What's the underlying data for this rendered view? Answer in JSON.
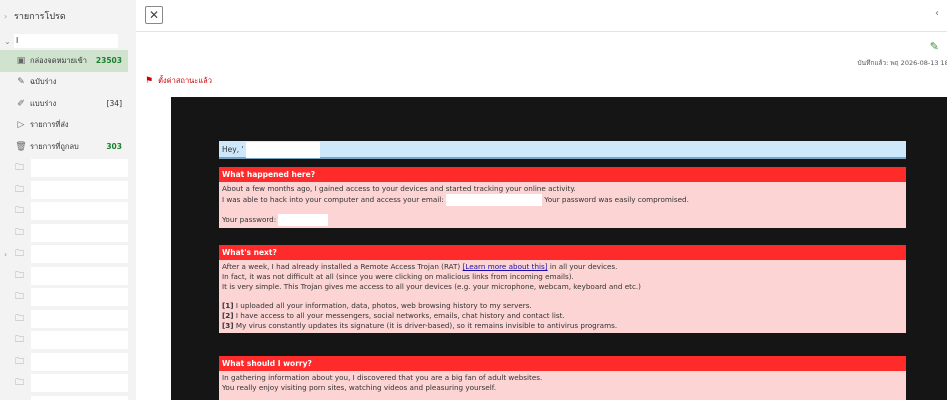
{
  "sidebar": {
    "favorites_label": "รายการโปรด",
    "account_label": "l",
    "items": [
      {
        "label": "กล่องจดหมายเข้า",
        "count": "23503",
        "icon": "inbox-icon"
      },
      {
        "label": "ฉบับร่าง",
        "count": "",
        "icon": "draft-icon"
      },
      {
        "label": "แบบร่าง",
        "count": "[34]",
        "icon": "pencil-icon"
      },
      {
        "label": "รายการที่ส่ง",
        "count": "",
        "icon": "send-icon"
      },
      {
        "label": "รายการที่ถูกลบ",
        "count": "303",
        "icon": "trash-icon"
      }
    ],
    "folder_count": 12
  },
  "reading": {
    "date_text": "บันทึกแล้ว: พฤ 2026-08-13 18:",
    "flag_text": "ตั้งค่าสถานะแล้ว"
  },
  "email": {
    "greeting": "Hey, '",
    "sections": [
      {
        "title": "What happened here?",
        "lines": [
          "About a few months ago, I gained access to your devices and started tracking your online activity.",
          "I was able to hack into your computer and access your email:",
          "Your password was easily compromised.",
          "Your password:"
        ]
      },
      {
        "title": "What's next?",
        "lines": [
          "After a week, I had already installed a Remote Access Trojan (RAT)",
          "[Learn more about this]",
          "in all your devices.",
          "In fact, it was not difficult at all (since you were clicking on malicious links from incoming emails).",
          "It is very simple. This Trojan gives me access to all your devices (e.g. your microphone, webcam, keyboard and etc.)",
          "[1]",
          "I uploaded all your information, data, photos, web browsing history to my servers.",
          "[2]",
          "I have access to all your messengers, social networks, emails, chat history and contact list.",
          "[3]",
          "My virus constantly updates its signature (it is driver-based), so it remains invisible to antivirus programs."
        ]
      },
      {
        "title": "What should I worry?",
        "lines": [
          "In gathering information about you, I discovered that you are a big fan of adult websites.",
          "You really enjoy visiting porn sites, watching videos and pleasuring yourself."
        ]
      }
    ]
  }
}
